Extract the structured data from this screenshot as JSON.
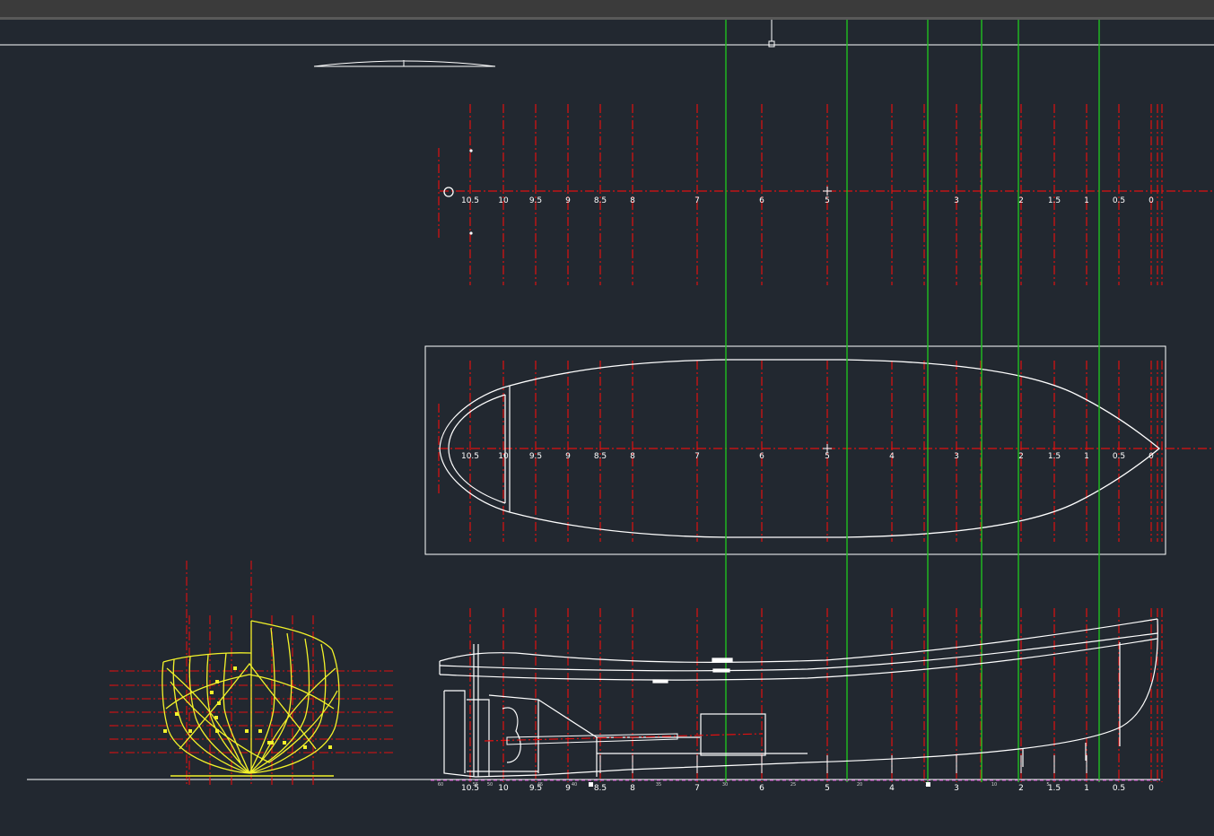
{
  "app": {
    "name": "CAD drawing viewport",
    "background_color": "#222830",
    "toolbar_color": "#3b3b3b"
  },
  "colors": {
    "station_line": "#e01010",
    "section_line": "#20c020",
    "hull_outline": "#ffffff",
    "body_plan": "#f2f22a",
    "grid_marker": "#f2f22a",
    "baseline_dash": "#c040c0"
  },
  "stations": {
    "labels": [
      "10.5",
      "10",
      "9.5",
      "9",
      "8.5",
      "8",
      "7",
      "6",
      "5",
      "4",
      "3",
      "2",
      "1.5",
      "1",
      "0.5",
      "0"
    ]
  },
  "top_view": {
    "labels": [
      "10.5",
      "10",
      "9.5",
      "9",
      "8.5",
      "8",
      "7",
      "6",
      "5",
      "3",
      "2",
      "1.5",
      "1",
      "0.5",
      "0"
    ]
  },
  "profile_view": {
    "minor_labels": [
      "60",
      "55",
      "50",
      "45",
      "40",
      "35",
      "30",
      "25",
      "20",
      "15",
      "10",
      "5"
    ]
  },
  "icons": [
    "origin-circle-icon",
    "crosshair-icon",
    "grip-square-icon"
  ]
}
